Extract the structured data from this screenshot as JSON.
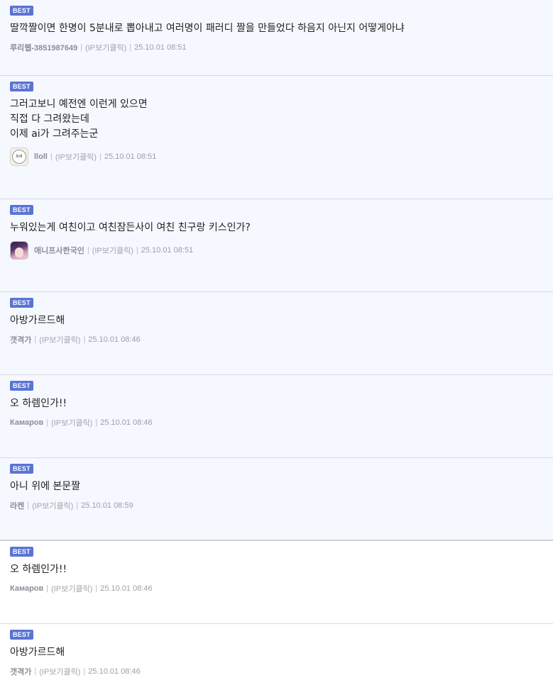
{
  "badge_label": "BEST",
  "ip_label": "(IP보기클릭)",
  "comments": [
    {
      "text": "딸깍짤이면 한명이 5분내로 뽑아내고 여러명이 패러디 짤을 만들었다 하음지 아닌지 어떻게아냐",
      "author": "루리웹-3851987649",
      "date": "25.10.01 08:51"
    },
    {
      "text": "그러고보니 예전엔 이런게 있으면\n직접 다 그려왔는데\n이제 ai가 그려주는군",
      "author": "lloll",
      "date": "25.10.01 08:51",
      "avatar_label": "lloll"
    },
    {
      "text": "누워있는게 여친이고 여친잠든사이 여친 친구랑 키스인가?",
      "author": "애니프사한국인",
      "date": "25.10.01 08:51"
    },
    {
      "text": "아방가르드해",
      "author": "갯격가",
      "date": "25.10.01 08:46"
    },
    {
      "text": "오 하렘인가!!",
      "author": "Камаров",
      "date": "25.10.01 08:46"
    },
    {
      "text": "아니 위에 본문짤",
      "author": "라켄",
      "date": "25.10.01 08:59"
    },
    {
      "text": "오 하렘인가!!",
      "author": "Камаров",
      "date": "25.10.01 08:46"
    },
    {
      "text": "아방가르드해",
      "author": "갯격가",
      "date": "25.10.01 08:46"
    }
  ],
  "colors": {
    "badge": "#5a74d6",
    "best_bg": "#f5f8fe"
  }
}
